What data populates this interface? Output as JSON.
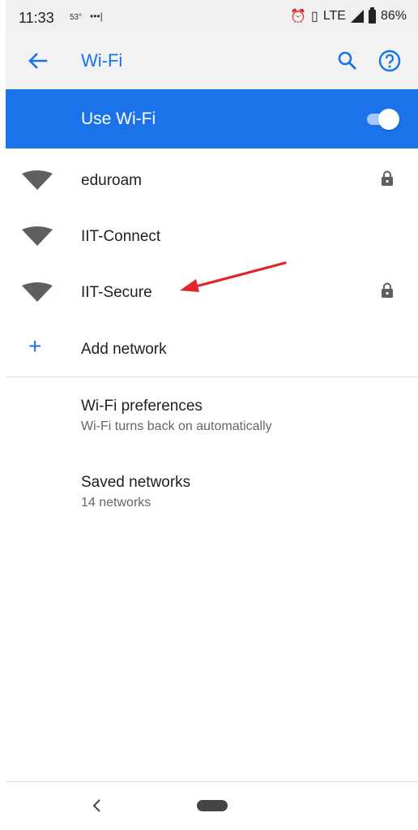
{
  "status_bar": {
    "time": "11:33",
    "temp": "53°",
    "dots": "•••|",
    "lte": "LTE",
    "battery": "86%"
  },
  "app_bar": {
    "title": "Wi-Fi"
  },
  "use_wifi": {
    "label": "Use Wi-Fi",
    "enabled": true
  },
  "networks": [
    {
      "name": "eduroam",
      "secured": true
    },
    {
      "name": "IIT-Connect",
      "secured": false
    },
    {
      "name": "IIT-Secure",
      "secured": true
    }
  ],
  "add_network": {
    "label": "Add network"
  },
  "preferences": [
    {
      "title": "Wi-Fi preferences",
      "subtitle": "Wi-Fi turns back on automatically"
    },
    {
      "title": "Saved networks",
      "subtitle": "14 networks"
    }
  ],
  "colors": {
    "accent": "#1a73e8",
    "annotation_arrow": "#e0262b"
  }
}
